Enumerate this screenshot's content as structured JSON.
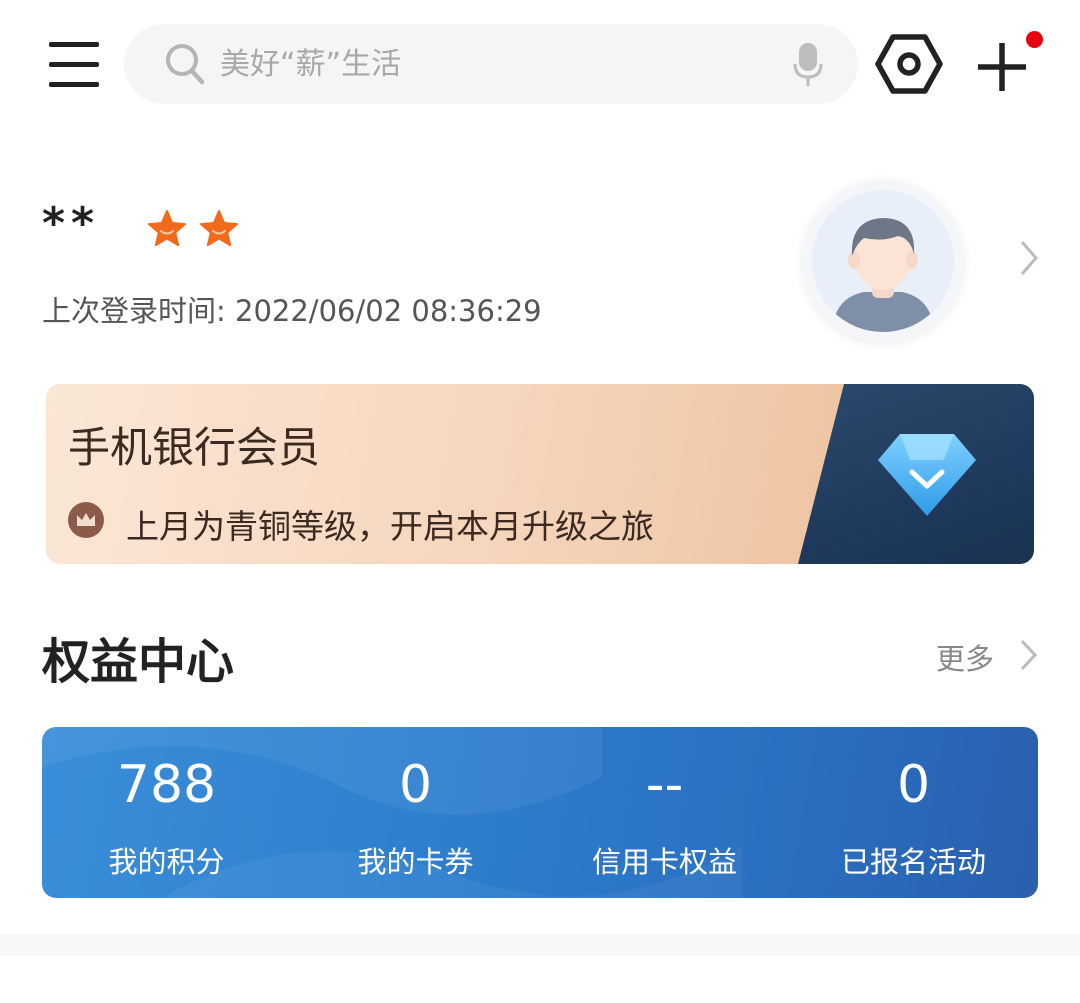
{
  "header": {
    "search_placeholder": "美好“薪”生活",
    "notification_dot_color": "#e60012"
  },
  "profile": {
    "name": "**",
    "star_count": 2,
    "star_color": "#f26a1b",
    "last_login_label": "上次登录时间:",
    "last_login_value": "2022/06/02 08:36:29"
  },
  "membership": {
    "title": "手机银行会员",
    "subtitle": "上月为青铜等级，开启本月升级之旅"
  },
  "rights_center": {
    "title": "权益中心",
    "more_label": "更多",
    "stats": [
      {
        "value": "788",
        "label": "我的积分"
      },
      {
        "value": "0",
        "label": "我的卡券"
      },
      {
        "value": "--",
        "label": "信用卡权益"
      },
      {
        "value": "0",
        "label": "已报名活动"
      }
    ]
  },
  "icons": {
    "menu": "hamburger-icon",
    "search": "search-icon",
    "mic": "microphone-icon",
    "scan": "hexagon-scan-icon",
    "add": "plus-icon",
    "avatar": "user-avatar",
    "chevron": "chevron-right-icon",
    "crown": "crown-icon",
    "diamond": "diamond-icon"
  }
}
